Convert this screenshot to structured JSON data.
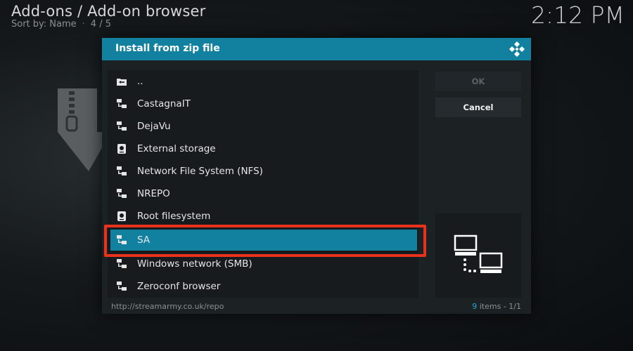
{
  "header": {
    "title": "Add-ons / Add-on browser",
    "sort_label": "Sort by: Name",
    "position": "4 / 5",
    "clock": "2:12 PM"
  },
  "dialog": {
    "title": "Install from zip file",
    "items": [
      {
        "label": "..",
        "icon": "folder-back-icon"
      },
      {
        "label": "CastagnaIT",
        "icon": "network-source-icon"
      },
      {
        "label": "DejaVu",
        "icon": "network-source-icon"
      },
      {
        "label": "External storage",
        "icon": "hard-drive-icon"
      },
      {
        "label": "Network File System (NFS)",
        "icon": "network-source-icon"
      },
      {
        "label": "NREPO",
        "icon": "network-source-icon"
      },
      {
        "label": "Root filesystem",
        "icon": "hard-drive-icon"
      },
      {
        "label": "SA",
        "icon": "network-source-icon",
        "selected": true
      },
      {
        "label": "Windows network (SMB)",
        "icon": "network-source-icon"
      },
      {
        "label": "Zeroconf browser",
        "icon": "network-source-icon"
      }
    ],
    "ok_label": "OK",
    "cancel_label": "Cancel",
    "footer_url": "http://streamarmy.co.uk/repo",
    "item_count": "9",
    "items_label": "items - 1/1"
  },
  "colors": {
    "accent": "#12809f",
    "highlight_outline": "#e8321c",
    "count_accent": "#24a7d4"
  }
}
